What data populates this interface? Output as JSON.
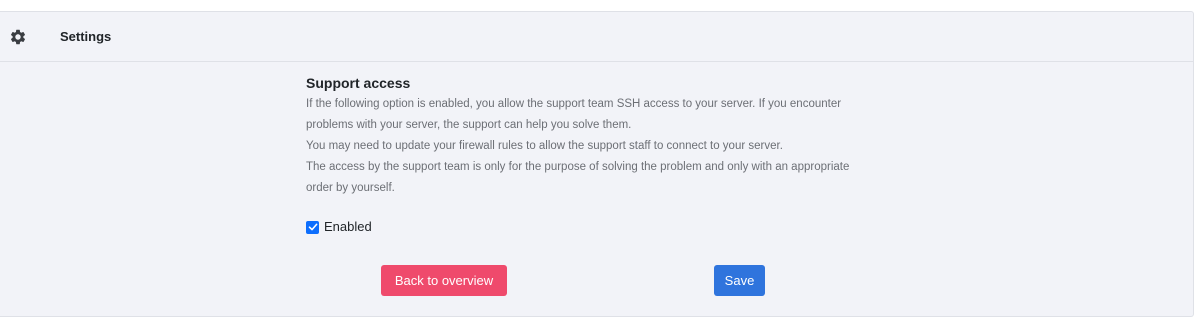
{
  "header": {
    "icon": "gear-icon",
    "title": "Settings"
  },
  "support": {
    "title": "Support access",
    "description": [
      "If the following option is enabled, you allow the support team SSH access to your server. If you encounter",
      "problems with your server, the support can help you solve them.",
      "You may need to update your firewall rules to allow the support staff to connect to your server.",
      "The access by the support team is only for the purpose of solving the problem and only with an appropriate",
      "order by yourself."
    ],
    "enabled_label": "Enabled",
    "enabled": true
  },
  "buttons": {
    "back_label": "Back to overview",
    "save_label": "Save"
  },
  "colors": {
    "back_button": "#ef4a6c",
    "save_button": "#2f74dd",
    "checkbox": "#0d6efd",
    "panel_background": "#f2f3f8"
  }
}
